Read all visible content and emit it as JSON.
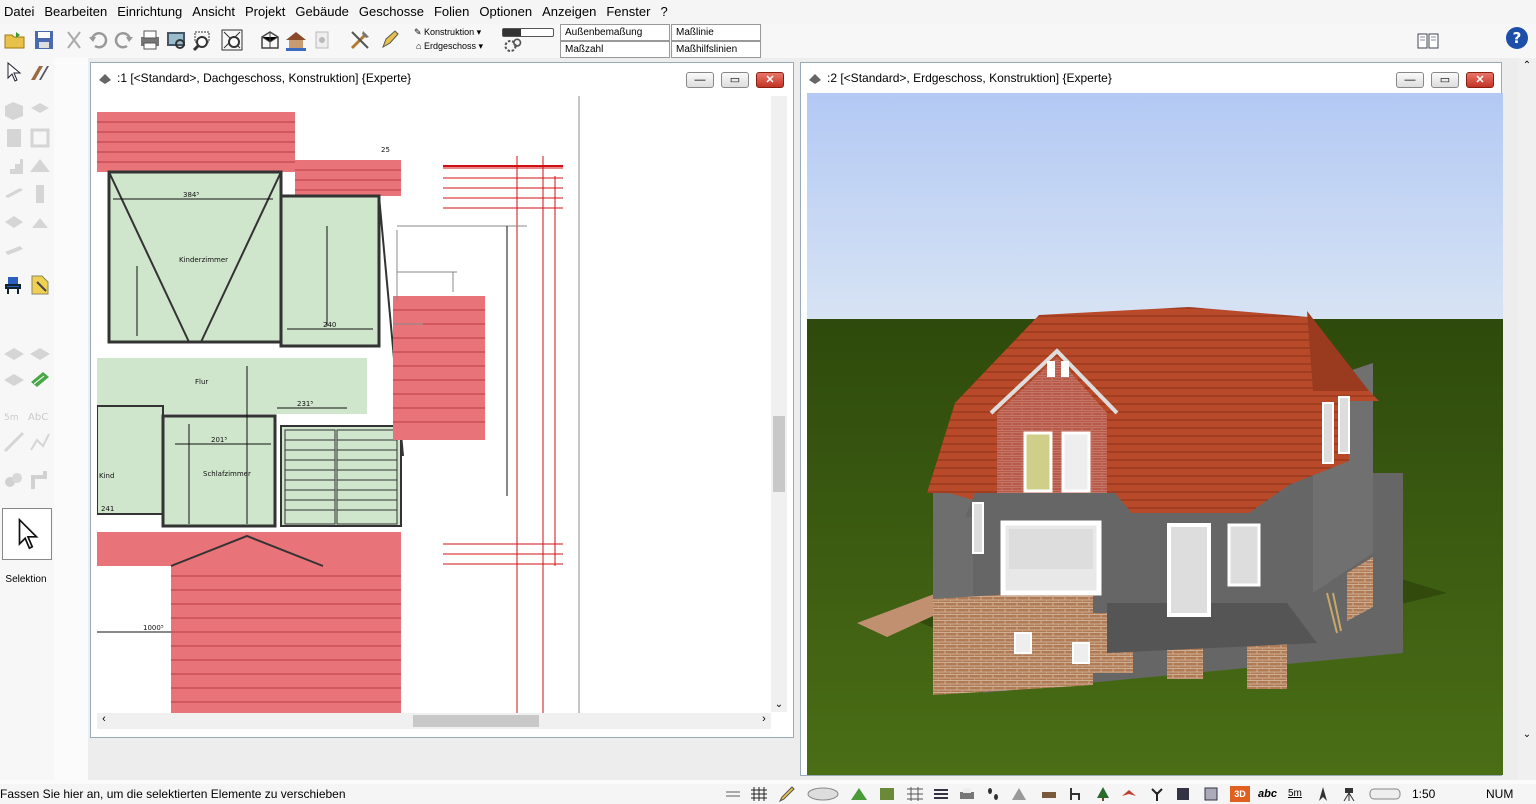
{
  "menu": [
    "Datei",
    "Bearbeiten",
    "Einrichtung",
    "Ansicht",
    "Projekt",
    "Gebäude",
    "Geschosse",
    "Folien",
    "Optionen",
    "Anzeigen",
    "Fenster",
    "?"
  ],
  "toolbar": {
    "layer_dropdown": "Konstruktion",
    "floor_dropdown": "Erdgeschoss",
    "dim_fields": [
      "Außenbemaßung",
      "Maßlinie",
      "Maßzahl",
      "Maßhilfslinien"
    ]
  },
  "palette": {
    "selection_label": "Selektion"
  },
  "window1": {
    "title": ":1 [<Standard>, Dachgeschoss, Konstruktion] {Experte}",
    "buttons": {
      "minimize": "—",
      "maximize": "▭",
      "close": "✕"
    },
    "plan_labels": {
      "dim1": "384⁵",
      "dim2": "240",
      "dim3": "231⁵",
      "dim4": "201⁵",
      "dim5": "1000⁵",
      "room1": "Kinderzimmer",
      "room2": "Flur",
      "room3": "Schlafzimmer",
      "room4": "Kind",
      "dim6": "25",
      "dim7": "241"
    }
  },
  "window2": {
    "title": ":2 [<Standard>, Erdgeschoss, Konstruktion] {Experte}",
    "buttons": {
      "minimize": "—",
      "maximize": "▭",
      "close": "✕"
    }
  },
  "statusbar": {
    "message": "Fassen Sie hier an, um die selektierten Elemente zu verschieben",
    "text_tool": "abc",
    "dim_tool": "5m",
    "badge": "3D",
    "scale": "1:50",
    "num": "NUM"
  },
  "colors": {
    "roof": "#b84a2a",
    "grass": "#3f5e10",
    "sky_top": "#b3c9f4",
    "plan_room": "#cfe6cc",
    "plan_roof": "#e8747a"
  }
}
